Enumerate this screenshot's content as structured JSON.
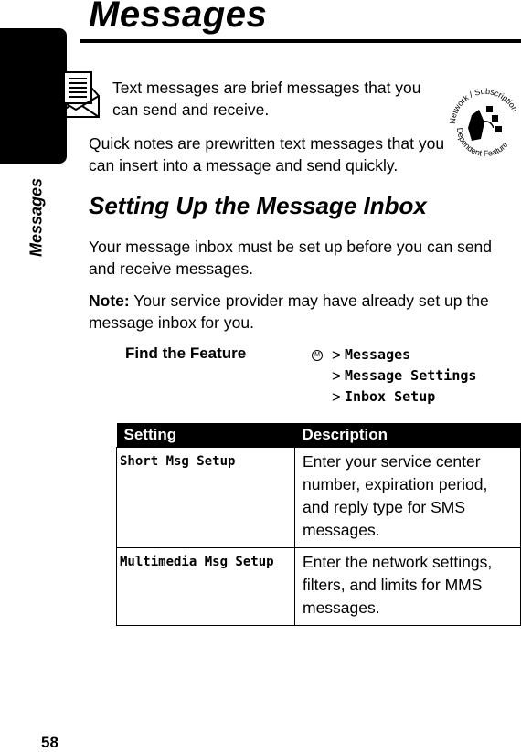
{
  "page": {
    "section_tab": "Messages",
    "page_number": "58",
    "title": "Messages"
  },
  "intro": {
    "text_messages": "Text messages are brief messages that you can send and receive.",
    "quick_notes": "Quick notes are prewritten text messages that you can insert into a message and send quickly.",
    "badge_top": "Network / Subscription",
    "badge_bottom": "Dependent Feature"
  },
  "section": {
    "heading": "Setting Up the Message Inbox",
    "paragraph": "Your message inbox must be set up before you can send and receive messages.",
    "note_label": "Note:",
    "note_text": " Your service provider may have already set up the message inbox for you."
  },
  "find_the_feature": {
    "label": "Find the Feature",
    "menu_key_glyph": "M",
    "separator": ">",
    "path": [
      "Messages",
      "Message Settings",
      "Inbox Setup"
    ]
  },
  "table": {
    "headers": [
      "Setting",
      "Description"
    ],
    "rows": [
      {
        "setting": "Short Msg Setup",
        "description": "Enter your service center number, expiration period, and reply type for SMS messages."
      },
      {
        "setting": "Multimedia Msg Setup",
        "description": "Enter the network settings, filters, and limits for MMS messages."
      }
    ]
  }
}
